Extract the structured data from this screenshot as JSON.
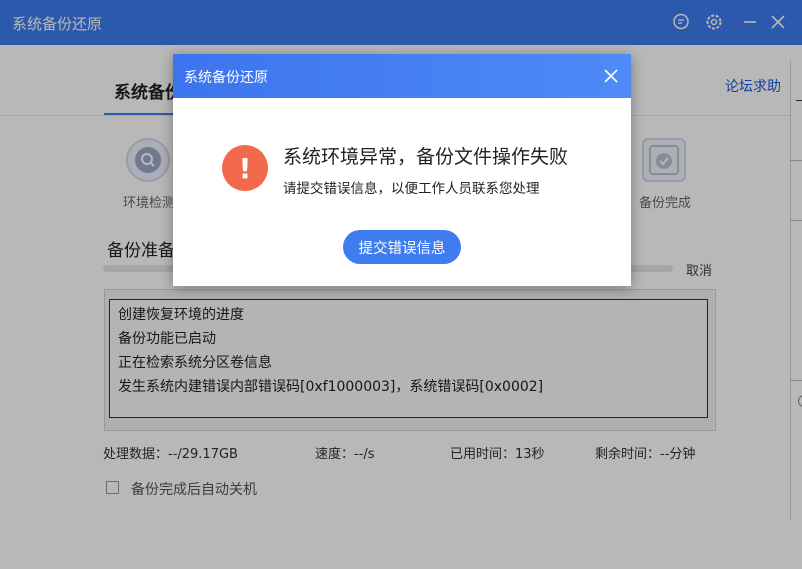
{
  "window": {
    "title": "系统备份还原"
  },
  "header": {
    "active_tab": "系统备份",
    "forum_link": "论坛求助"
  },
  "steps": [
    {
      "label": "环境检测",
      "icon": "search-icon"
    },
    {
      "label": "备份完成",
      "icon": "check-shield-icon"
    }
  ],
  "main": {
    "section_title": "备份准备",
    "cancel_label": "取消",
    "log_lines": [
      "创建恢复环境的进度",
      "备份功能已启动",
      "正在检索系统分区卷信息",
      "发生系统内建错误内部错误码[0xf1000003]，系统错误码[0x0002]"
    ],
    "stats": {
      "processed": "处理数据：--/29.17GB",
      "speed": "速度：--/s",
      "elapsed": "已用时间：13秒",
      "remaining": "剩余时间：--分钟"
    },
    "auto_shutdown_label": "备份完成后自动关机"
  },
  "dialog": {
    "title": "系统备份还原",
    "message_main": "系统环境异常，备份文件操作失败",
    "message_sub": "请提交错误信息，以便工作人员联系您处理",
    "submit_label": "提交错误信息"
  },
  "colors": {
    "accent": "#3f7cf0",
    "warning": "#f26a4b"
  }
}
